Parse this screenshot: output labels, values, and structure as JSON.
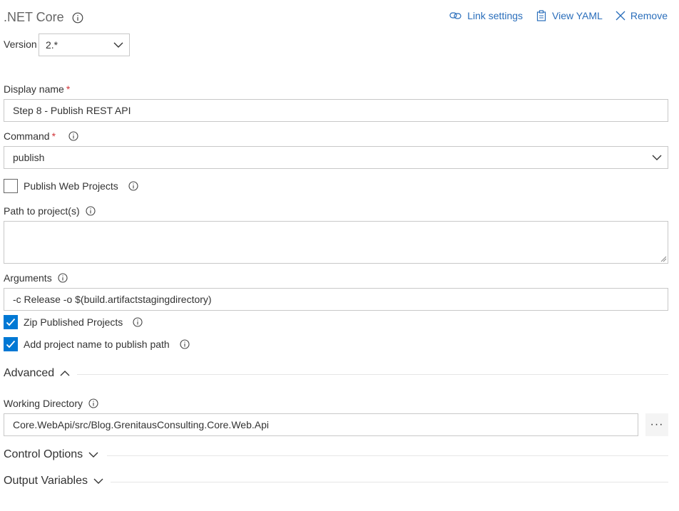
{
  "task": {
    "title": ".NET Core",
    "actions": {
      "link_settings": "Link settings",
      "view_yaml": "View YAML",
      "remove": "Remove"
    }
  },
  "version": {
    "label": "Version",
    "value": "2.*"
  },
  "display_name": {
    "label": "Display name",
    "required_mark": "*",
    "value": "Step 8 - Publish REST API"
  },
  "command": {
    "label": "Command",
    "required_mark": "*",
    "value": "publish"
  },
  "publish_web_projects": {
    "label": "Publish Web Projects",
    "checked": false
  },
  "path_to_projects": {
    "label": "Path to project(s)",
    "value": ""
  },
  "arguments": {
    "label": "Arguments",
    "value": "-c Release -o $(build.artifactstagingdirectory)"
  },
  "zip_published": {
    "label": "Zip Published Projects",
    "checked": true
  },
  "add_project_name": {
    "label": "Add project name to publish path",
    "checked": true
  },
  "advanced": {
    "label": "Advanced",
    "expanded": true,
    "working_directory": {
      "label": "Working Directory",
      "value": "Core.WebApi/src/Blog.GrenitausConsulting.Core.Web.Api",
      "browse_label": "···"
    }
  },
  "control_options": {
    "label": "Control Options",
    "expanded": false
  },
  "output_variables": {
    "label": "Output Variables",
    "expanded": false
  },
  "colors": {
    "accent": "#0078d4",
    "link": "#2a6ebb",
    "required": "#d13438",
    "border": "#c8c8c8"
  }
}
